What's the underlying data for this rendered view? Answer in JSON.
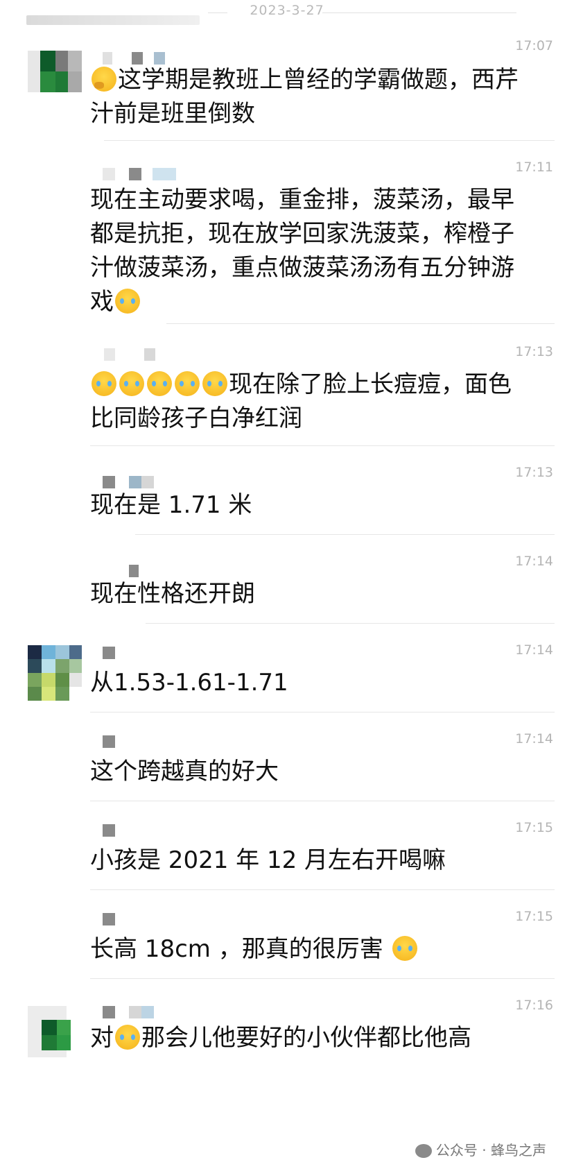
{
  "date_divider": "2023-3-27",
  "watermark": "公众号 · 蜂鸟之声",
  "messages": [
    {
      "time": "17:07",
      "text": "这学期是教班上曾经的学霸做题，西芹汁前是班里倒数"
    },
    {
      "time": "17:11",
      "text": "现在主动要求喝，重金排，菠菜汤，最早都是抗拒，现在放学回家洗菠菜，榨橙子汁做菠菜汤，重点做菠菜汤汤有五分钟游戏"
    },
    {
      "time": "17:13",
      "text": "现在除了脸上长痘痘，面色比同龄孩子白净红润"
    },
    {
      "time": "17:13",
      "text": "现在是 1.71 米"
    },
    {
      "time": "17:14",
      "text": "现在性格还开朗"
    },
    {
      "time": "17:14",
      "text": "从1.53-1.61-1.71"
    },
    {
      "time": "17:14",
      "text": "这个跨越真的好大"
    },
    {
      "time": "17:15",
      "text": "小孩是 2021 年 12 月左右开喝嘛"
    },
    {
      "time": "17:15",
      "text": "长高 18cm ，那真的很厉害"
    },
    {
      "time": "17:16",
      "text_before": "对",
      "text_after": "那会儿他要好的小伙伴都比他高"
    }
  ],
  "emoji_names": [
    "thinking-face-icon",
    "face-with-tears-icon",
    "face-with-tears-icon",
    "face-with-tears-icon",
    "face-with-tears-icon",
    "face-with-tears-icon",
    "face-with-tears-icon",
    "joy-icon",
    "joy-icon"
  ]
}
